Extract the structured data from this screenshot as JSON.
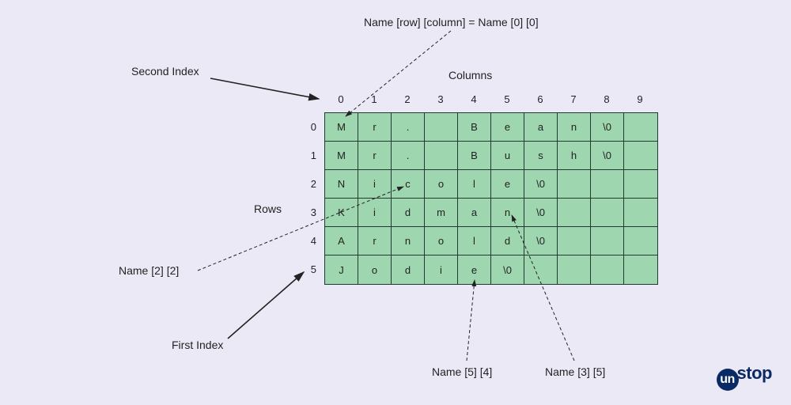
{
  "labels": {
    "title_top": "Name [row] [column] = Name [0] [0]",
    "second_index": "Second Index",
    "columns": "Columns",
    "rows": "Rows",
    "name22": "Name [2] [2]",
    "first_index": "First Index",
    "name54": "Name [5] [4]",
    "name35": "Name [3] [5]"
  },
  "col_indices": [
    "0",
    "1",
    "2",
    "3",
    "4",
    "5",
    "6",
    "7",
    "8",
    "9"
  ],
  "row_indices": [
    "0",
    "1",
    "2",
    "3",
    "4",
    "5"
  ],
  "grid": [
    [
      "M",
      "r",
      ".",
      " ",
      "B",
      "e",
      "a",
      "n",
      "\\0",
      ""
    ],
    [
      "M",
      "r",
      ".",
      " ",
      "B",
      "u",
      "s",
      "h",
      "\\0",
      ""
    ],
    [
      "N",
      "i",
      "c",
      "o",
      "l",
      "e",
      "\\0",
      "",
      "",
      ""
    ],
    [
      "K",
      "i",
      "d",
      "m",
      "a",
      "n",
      "\\0",
      "",
      "",
      ""
    ],
    [
      "A",
      "r",
      "n",
      "o",
      "l",
      "d",
      "\\0",
      "",
      "",
      ""
    ],
    [
      "J",
      "o",
      "d",
      "i",
      "e",
      "\\0",
      "",
      "",
      "",
      ""
    ]
  ],
  "logo": {
    "mark": "un",
    "rest": "stop"
  },
  "chart_data": {
    "type": "table",
    "description": "2D character array Name[6][10] storing strings as rows of characters with null terminators",
    "columns": 10,
    "rows": 6,
    "data": [
      [
        "M",
        "r",
        ".",
        " ",
        "B",
        "e",
        "a",
        "n",
        "\\0",
        ""
      ],
      [
        "M",
        "r",
        ".",
        " ",
        "B",
        "u",
        "s",
        "h",
        "\\0",
        ""
      ],
      [
        "N",
        "i",
        "c",
        "o",
        "l",
        "e",
        "\\0",
        "",
        "",
        ""
      ],
      [
        "K",
        "i",
        "d",
        "m",
        "a",
        "n",
        "\\0",
        "",
        "",
        ""
      ],
      [
        "A",
        "r",
        "n",
        "o",
        "l",
        "d",
        "\\0",
        "",
        "",
        ""
      ],
      [
        "J",
        "o",
        "d",
        "i",
        "e",
        "\\0",
        "",
        "",
        "",
        ""
      ]
    ],
    "annotations": [
      {
        "text": "Name [row] [column] = Name [0] [0]",
        "points_to": [
          0,
          0
        ]
      },
      {
        "text": "Second Index",
        "points_to_axis": "column_0_header"
      },
      {
        "text": "First Index",
        "points_to_axis": "row_5_header"
      },
      {
        "text": "Name [2] [2]",
        "points_to": [
          2,
          2
        ]
      },
      {
        "text": "Name [5] [4]",
        "points_to": [
          5,
          4
        ]
      },
      {
        "text": "Name [3] [5]",
        "points_to": [
          3,
          5
        ]
      }
    ],
    "axis_labels": {
      "x": "Columns",
      "y": "Rows"
    }
  }
}
